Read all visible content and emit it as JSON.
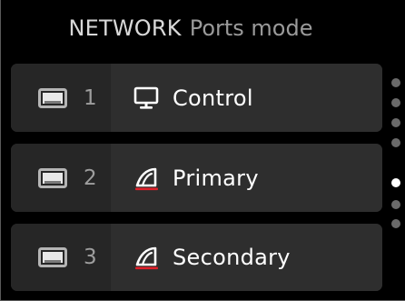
{
  "header": {
    "title": "NETWORK",
    "subtitle": "Ports mode"
  },
  "ports": [
    {
      "number": "1",
      "mode": "Control",
      "mode_icon": "monitor-icon"
    },
    {
      "number": "2",
      "mode": "Primary",
      "mode_icon": "dante-icon"
    },
    {
      "number": "3",
      "mode": "Secondary",
      "mode_icon": "dante-icon"
    }
  ],
  "pager": {
    "total": 7,
    "active_index": 4
  },
  "colors": {
    "background": "#000000",
    "row": "#2e2e2e",
    "accent_red": "#e0202a",
    "muted_text": "#9a9a9a"
  }
}
